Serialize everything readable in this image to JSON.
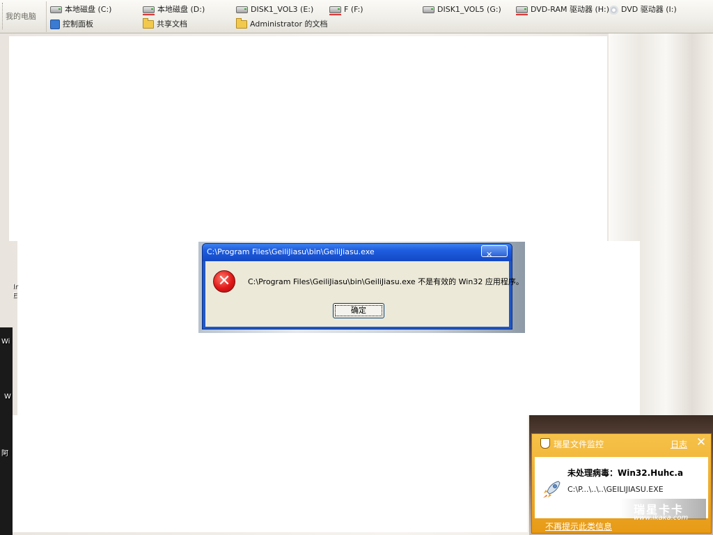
{
  "toolbar": {
    "title": "我的电脑",
    "row1": [
      {
        "label": "本地磁盘 (C:)",
        "icon": "hard-drive-icon"
      },
      {
        "label": "本地磁盘 (D:)",
        "icon": "hard-drive-icon"
      },
      {
        "label": "DISK1_VOL3 (E:)",
        "icon": "hard-drive-icon"
      },
      {
        "label": "F (F:)",
        "icon": "hard-drive-icon"
      },
      {
        "label": "DISK1_VOL5 (G:)",
        "icon": "hard-drive-icon"
      },
      {
        "label": "DVD-RAM 驱动器 (H:)",
        "icon": "dvd-drive-icon"
      },
      {
        "label": "DVD 驱动器 (I:)",
        "icon": "cd-drive-icon"
      }
    ],
    "row2": [
      {
        "label": "控制面板",
        "icon": "control-panel-icon"
      },
      {
        "label": "共享文档",
        "icon": "folder-icon"
      },
      {
        "label": "Administrator 的文档",
        "icon": "folder-icon"
      }
    ]
  },
  "error_dialog": {
    "title": "C:\\Program Files\\GeiliJiasu\\bin\\GeiliJiasu.exe",
    "close_label": "✕",
    "message": "C:\\Program Files\\GeiliJiasu\\bin\\GeiliJiasu.exe 不是有效的 Win32 应用程序。",
    "ok_label": "确定",
    "icon_glyph": "✕"
  },
  "antivirus_popup": {
    "title": "瑞星文件监控",
    "log_link": "日志",
    "close_glyph": "✕",
    "virus_label": "未处理病毒：Win32.Huhc.a",
    "file_path": "C:\\P...\\..\\..\\GEILIJIASU.EXE",
    "watermark": "瑞星卡卡",
    "watermark_url": "www.ikaka.com",
    "footer_link": "不再提示此类信息"
  },
  "desktop_edge_labels": [
    "Ir",
    "E",
    "Wi",
    "W",
    "阿"
  ]
}
